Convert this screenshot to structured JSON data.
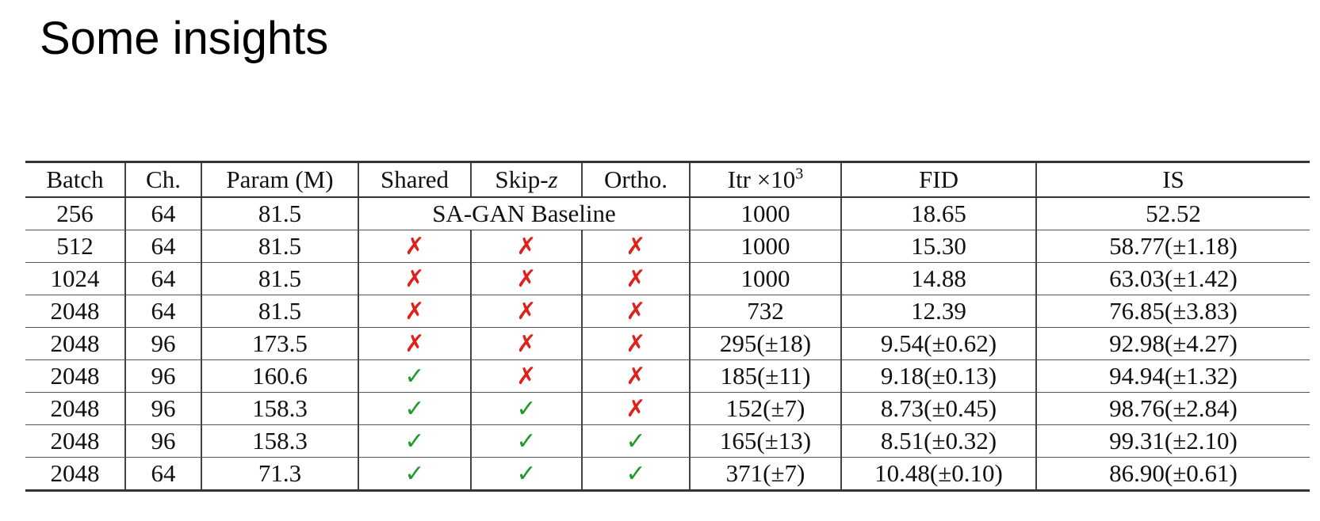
{
  "slide": {
    "title": "Some insights"
  },
  "colors": {
    "cross": "#e0201b",
    "check": "#1e9a2a"
  },
  "icons": {
    "yes": "check-icon",
    "no": "cross-icon"
  },
  "table": {
    "headers": {
      "batch": "Batch",
      "ch": "Ch.",
      "param": "Param (M)",
      "shared": "Shared",
      "skipz_prefix": "Skip-",
      "skipz_var": "z",
      "ortho": "Ortho.",
      "itr_prefix": "Itr ×10",
      "itr_exp": "3",
      "fid": "FID",
      "is": "IS"
    },
    "baseline": {
      "batch": "256",
      "ch": "64",
      "param": "81.5",
      "label": "SA-GAN Baseline",
      "itr": "1000",
      "fid": "18.65",
      "is": "52.52"
    },
    "rows": [
      {
        "batch": "512",
        "ch": "64",
        "param": "81.5",
        "shared": "✗",
        "shared_on": false,
        "skipz": "✗",
        "skipz_on": false,
        "ortho": "✗",
        "ortho_on": false,
        "itr": "1000",
        "fid": "15.30",
        "is": "58.77(±1.18)"
      },
      {
        "batch": "1024",
        "ch": "64",
        "param": "81.5",
        "shared": "✗",
        "shared_on": false,
        "skipz": "✗",
        "skipz_on": false,
        "ortho": "✗",
        "ortho_on": false,
        "itr": "1000",
        "fid": "14.88",
        "is": "63.03(±1.42)"
      },
      {
        "batch": "2048",
        "ch": "64",
        "param": "81.5",
        "shared": "✗",
        "shared_on": false,
        "skipz": "✗",
        "skipz_on": false,
        "ortho": "✗",
        "ortho_on": false,
        "itr": "732",
        "fid": "12.39",
        "is": "76.85(±3.83)"
      },
      {
        "batch": "2048",
        "ch": "96",
        "param": "173.5",
        "shared": "✗",
        "shared_on": false,
        "skipz": "✗",
        "skipz_on": false,
        "ortho": "✗",
        "ortho_on": false,
        "itr": "295(±18)",
        "fid": "9.54(±0.62)",
        "is": "92.98(±4.27)"
      },
      {
        "batch": "2048",
        "ch": "96",
        "param": "160.6",
        "shared": "✓",
        "shared_on": true,
        "skipz": "✗",
        "skipz_on": false,
        "ortho": "✗",
        "ortho_on": false,
        "itr": "185(±11)",
        "fid": "9.18(±0.13)",
        "is": "94.94(±1.32)"
      },
      {
        "batch": "2048",
        "ch": "96",
        "param": "158.3",
        "shared": "✓",
        "shared_on": true,
        "skipz": "✓",
        "skipz_on": true,
        "ortho": "✗",
        "ortho_on": false,
        "itr": "152(±7)",
        "fid": "8.73(±0.45)",
        "is": "98.76(±2.84)"
      },
      {
        "batch": "2048",
        "ch": "96",
        "param": "158.3",
        "shared": "✓",
        "shared_on": true,
        "skipz": "✓",
        "skipz_on": true,
        "ortho": "✓",
        "ortho_on": true,
        "itr": "165(±13)",
        "fid": "8.51(±0.32)",
        "is": "99.31(±2.10)"
      },
      {
        "batch": "2048",
        "ch": "64",
        "param": "71.3",
        "shared": "✓",
        "shared_on": true,
        "skipz": "✓",
        "skipz_on": true,
        "ortho": "✓",
        "ortho_on": true,
        "itr": "371(±7)",
        "fid": "10.48(±0.10)",
        "is": "86.90(±0.61)"
      }
    ]
  }
}
